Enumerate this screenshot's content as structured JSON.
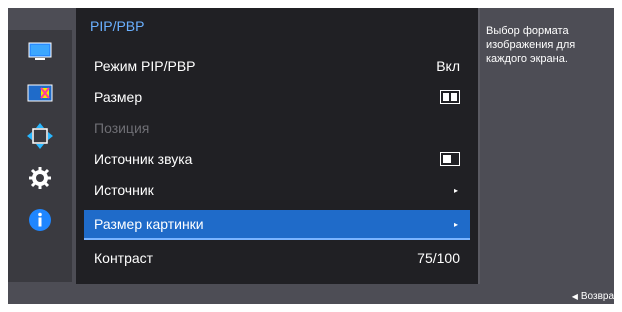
{
  "menu": {
    "title": "PIP/PBP",
    "items": [
      {
        "label": "Режим PIP/PBP",
        "value": "Вкл"
      },
      {
        "label": "Размер",
        "icon": "pbp-split-icon"
      },
      {
        "label": "Позиция",
        "disabled": true
      },
      {
        "label": "Источник звука",
        "icon": "pip-left-window-icon"
      },
      {
        "label": "Источник",
        "arrow": "▸"
      },
      {
        "label": "Размер картинки",
        "arrow": "▸",
        "selected": true
      },
      {
        "label": "Контраст",
        "value": "75/100"
      }
    ]
  },
  "help": {
    "text": "Выбор формата изображения для каждого экрана."
  },
  "footer": {
    "back_arrow": "◀",
    "back_label": "Возвра"
  },
  "sidebar": {
    "icons": [
      "monitor-icon",
      "color-icon",
      "resize-icon",
      "gear-icon",
      "info-icon"
    ]
  },
  "colors": {
    "accent": "#1f6bc9",
    "title": "#6ab0ff"
  }
}
